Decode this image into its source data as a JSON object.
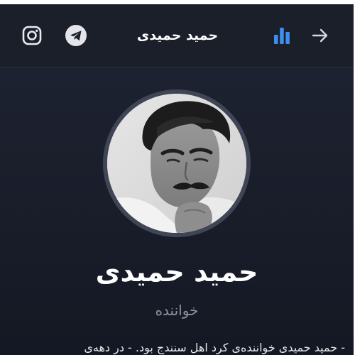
{
  "header": {
    "title": "حمید حمیدی",
    "icons": {
      "instagram": "instagram-icon",
      "telegram": "telegram-icon",
      "stats": "bar-chart-icon",
      "back": "arrow-right-icon"
    }
  },
  "profile": {
    "name": "حمید حمیدی",
    "role": "خواننده",
    "bio": "- حمید حمیدی خواننده‌ی کرد اهل سنندج بود. - در دهه‌ی"
  },
  "colors": {
    "background": "#1b1f29",
    "accent": "#3d8ef0",
    "text": "#ffffff",
    "muted": "#8b92a3"
  }
}
